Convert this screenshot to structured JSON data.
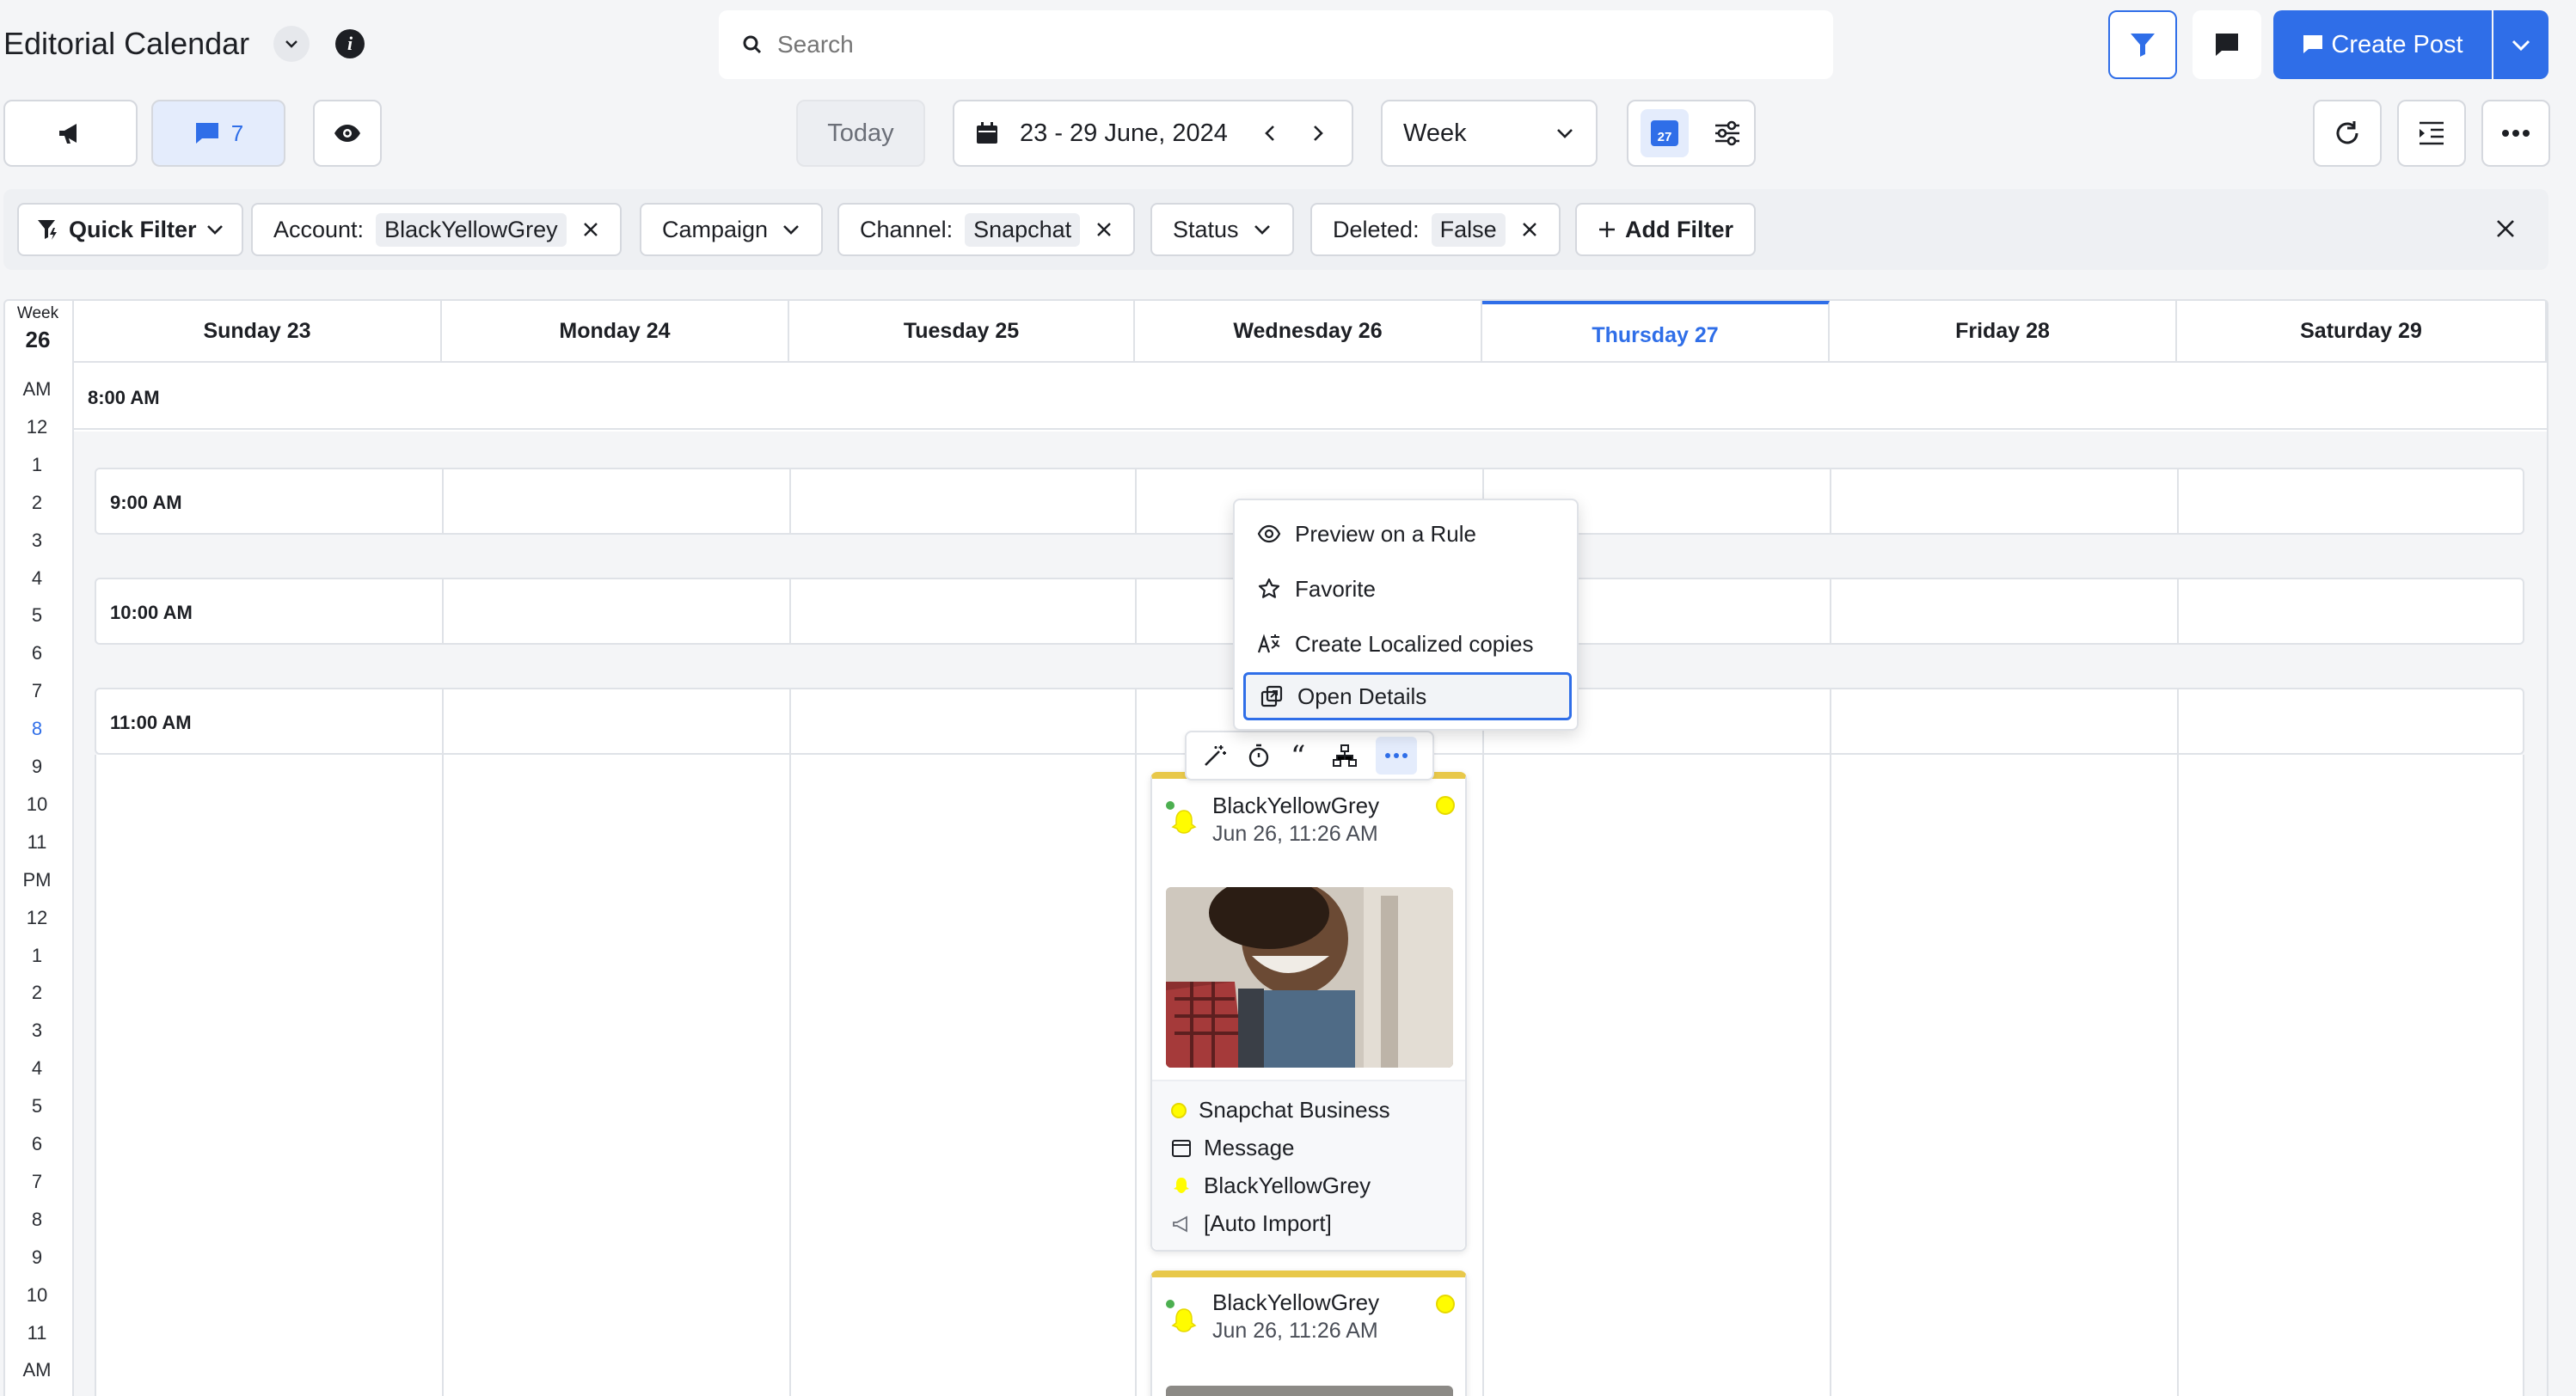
{
  "app": {
    "title": "Editorial Calendar"
  },
  "search": {
    "placeholder": "Search"
  },
  "header": {
    "create_post_label": "Create Post"
  },
  "toolbar": {
    "messages_count": "7",
    "today_label": "Today",
    "date_range": "23 - 29 June, 2024",
    "view_select": "Week",
    "calendar_icon_day": "27"
  },
  "filters": {
    "quick_filter": "Quick Filter",
    "account_label": "Account:",
    "account_value": "BlackYellowGrey",
    "campaign_label": "Campaign",
    "channel_label": "Channel:",
    "channel_value": "Snapchat",
    "status_label": "Status",
    "deleted_label": "Deleted:",
    "deleted_value": "False",
    "add_filter_label": "Add Filter"
  },
  "calendar": {
    "week_label": "Week",
    "week_number": "26",
    "days": [
      "Sunday 23",
      "Monday 24",
      "Tuesday 25",
      "Wednesday 26",
      "Thursday 27",
      "Friday 28",
      "Saturday 29"
    ],
    "active_day_index": 4,
    "hours": [
      "AM",
      "12",
      "1",
      "2",
      "3",
      "4",
      "5",
      "6",
      "7",
      "8",
      "9",
      "10",
      "11",
      "PM",
      "12",
      "1",
      "2",
      "3",
      "4",
      "5",
      "6",
      "7",
      "8",
      "9",
      "10",
      "11",
      "AM"
    ],
    "current_hour_index": 9,
    "slots": [
      "8:00 AM",
      "9:00 AM",
      "10:00 AM",
      "11:00 AM"
    ]
  },
  "context_menu": {
    "items": [
      "Preview on a Rule",
      "Favorite",
      "Create Localized copies",
      "Open Details"
    ],
    "highlighted_index": 3
  },
  "post_card": {
    "account": "BlackYellowGrey",
    "datetime": "Jun 26, 11:26 AM",
    "channel": "Snapchat Business",
    "type": "Message",
    "profile": "BlackYellowGrey",
    "campaign": "[Auto Import]"
  },
  "post_card_2": {
    "account": "BlackYellowGrey",
    "datetime": "Jun 26, 11:26 AM"
  },
  "colors": {
    "accent": "#2f6ee8",
    "snapchat_yellow": "#fffc00",
    "card_top_border": "#e8c84a",
    "status_dot": "#4caf50"
  }
}
